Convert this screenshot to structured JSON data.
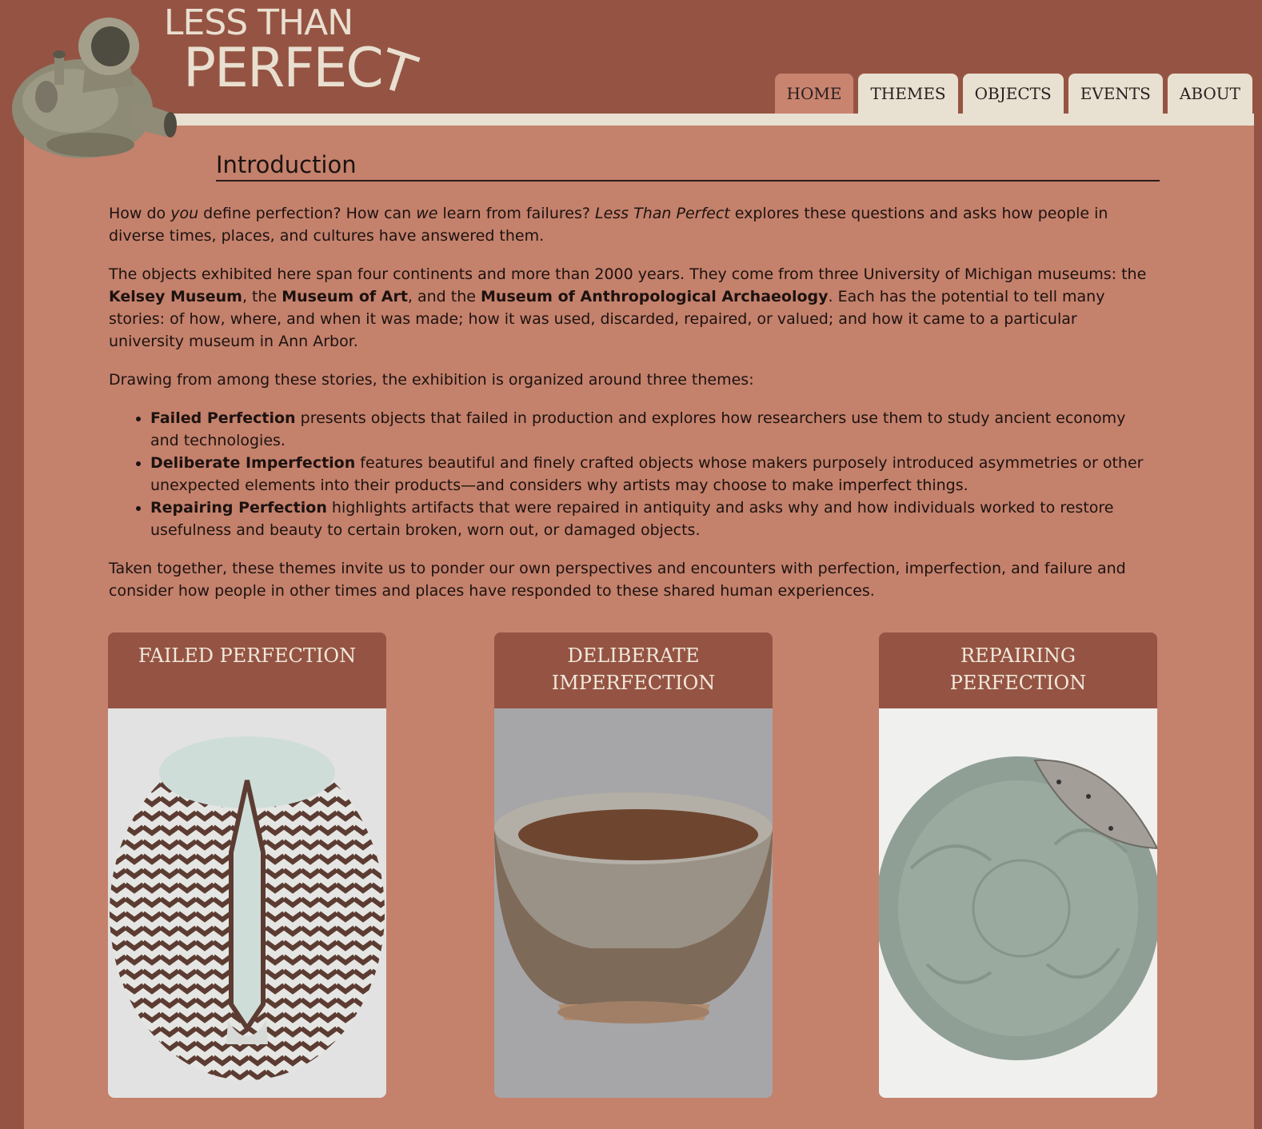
{
  "logo": {
    "line1": "LESS THAN",
    "line2_main": "PERFEC",
    "line2_t": "T"
  },
  "nav": {
    "tabs": [
      "HOME",
      "THEMES",
      "OBJECTS",
      "EVENTS",
      "ABOUT"
    ],
    "active": "HOME"
  },
  "intro": {
    "title": "Introduction",
    "p1": {
      "a": "How do ",
      "b": "you",
      "c": " define perfection? How can ",
      "d": "we",
      "e": " learn from failures? ",
      "f": "Less Than Perfect",
      "g": " explores these questions and asks how people in diverse times, places, and cultures have answered them."
    },
    "p2": {
      "a": "The objects exhibited here span four continents and more than 2000 years. They come from three University of Michigan museums: the ",
      "b": "Kelsey Museum",
      "c": ", the ",
      "d": "Museum of Art",
      "e": ", and the ",
      "f": "Museum of Anthropological Archaeology",
      "g": ". Each has the potential to tell many stories: of how, where, and when it was made; how it was used, discarded, repaired, or valued; and how it came to a particular university museum in Ann Arbor."
    },
    "p3": "Drawing from among these stories, the exhibition is organized around three themes:",
    "themes": [
      {
        "name": "Failed Perfection",
        "desc": " presents objects that failed in production and explores how researchers use them to study ancient economy and technologies."
      },
      {
        "name": "Deliberate Imperfection",
        "desc": " features beautiful and finely crafted objects whose makers purposely introduced asymmetries or other unexpected elements into their products—and considers why artists may choose to make imperfect things."
      },
      {
        "name": "Repairing Perfection",
        "desc": " highlights artifacts that were repaired in antiquity and asks why and how individuals worked to restore usefulness and beauty to certain broken, worn out, or damaged objects."
      }
    ],
    "p4": "Taken together, these themes invite us to ponder our own perspectives and encounters with perfection, imperfection, and failure and consider how people in other times and places have responded to these shared human experiences."
  },
  "cards": [
    {
      "title": "FAILED PERFECTION"
    },
    {
      "title_1": "DELIBERATE",
      "title_2": "IMPERFECTION"
    },
    {
      "title_1": "REPAIRING",
      "title_2": "PERFECTION"
    }
  ],
  "colors": {
    "page_bg": "#955443",
    "content_bg": "#c4816c",
    "tab_bg": "#e8e0d0",
    "tab_active": "#c98470"
  }
}
